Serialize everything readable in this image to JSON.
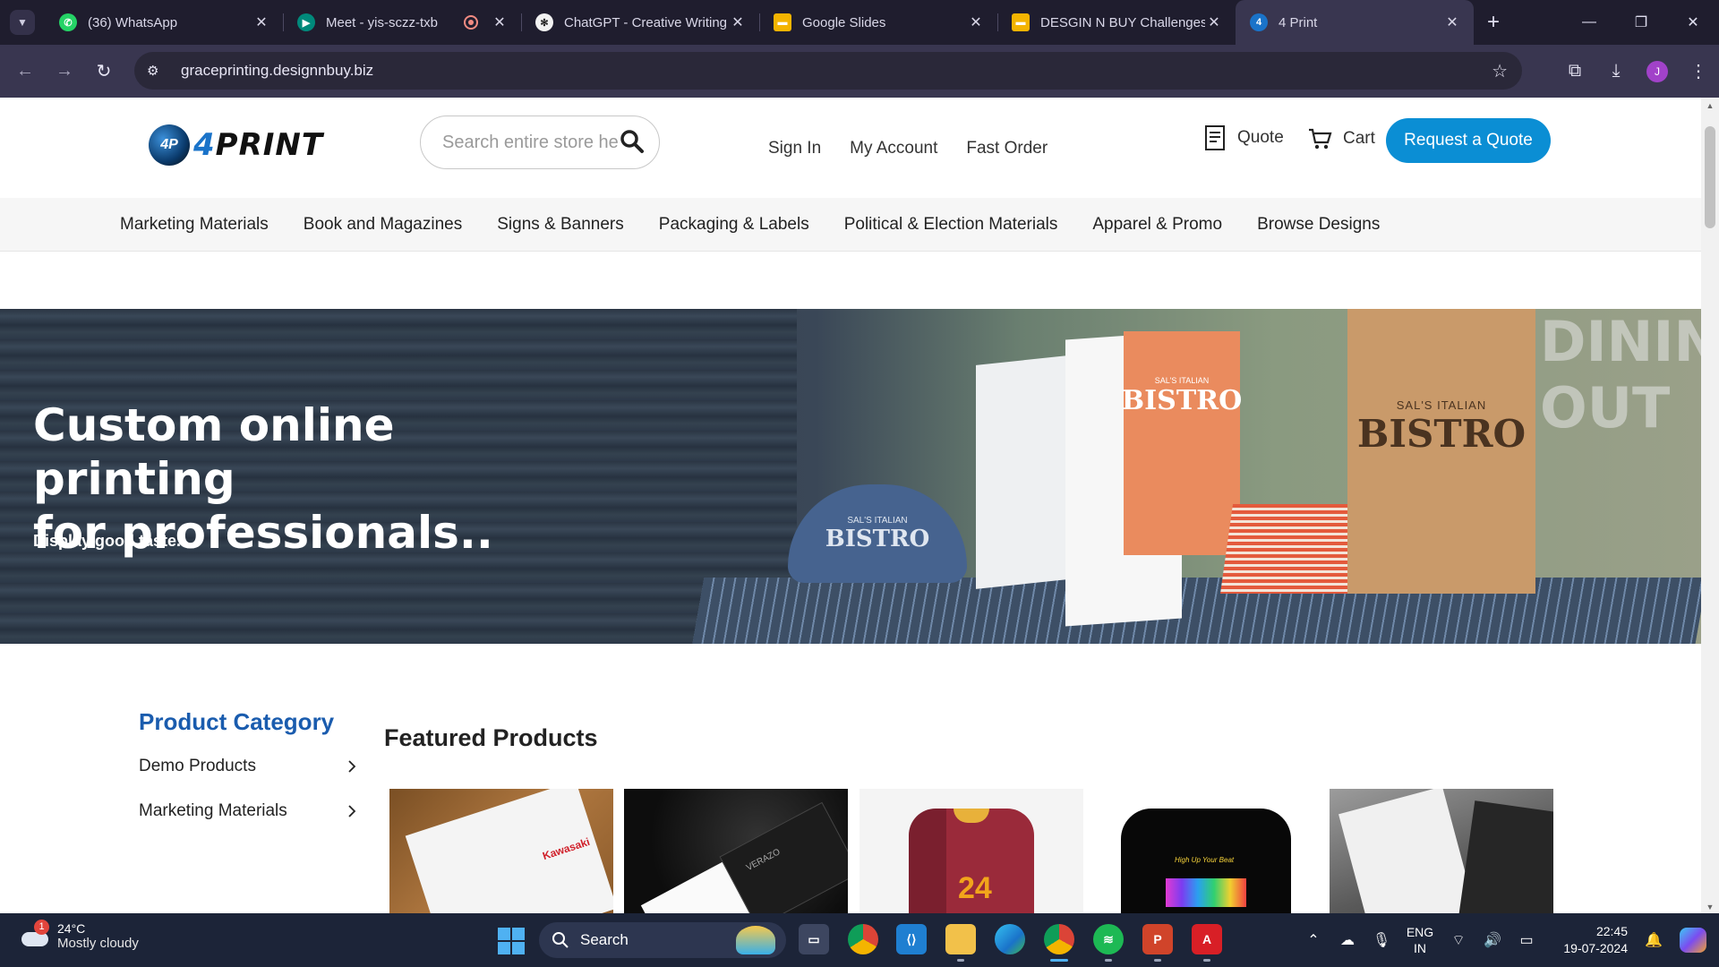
{
  "browser": {
    "tabs": [
      {
        "title": "(36) WhatsApp",
        "icon": "whatsapp-icon",
        "color": "#25d366",
        "glyph": "✆"
      },
      {
        "title": "Meet - yis-sczz-txb",
        "icon": "google-meet-icon",
        "color": "#00897b",
        "glyph": "▶"
      },
      {
        "title": "ChatGPT - Creative Writing",
        "icon": "chatgpt-icon",
        "color": "#f2f2f2",
        "glyph": "✻"
      },
      {
        "title": "Google Slides",
        "icon": "google-slides-icon",
        "color": "#f4b400",
        "glyph": "▬"
      },
      {
        "title": "DESGIN N BUY Challenges",
        "icon": "google-slides-icon",
        "color": "#f4b400",
        "glyph": "▬"
      },
      {
        "title": "4 Print",
        "icon": "4print-favicon-icon",
        "color": "#1a73c9",
        "glyph": "4"
      }
    ],
    "active_tab_index": 5,
    "url": "graceprinting.designnbuy.biz",
    "profile_initial": "J"
  },
  "header": {
    "logo_prefix": "4",
    "logo_text": "PRINT",
    "logo_globe_text": "4P",
    "search_placeholder": "Search entire store here...",
    "links": [
      "Sign In",
      "My Account",
      "Fast Order"
    ],
    "quote_label": "Quote",
    "cart_label": "Cart",
    "request_quote_label": "Request a Quote"
  },
  "nav": {
    "categories": [
      "Marketing Materials",
      "Book and Magazines",
      "Signs & Banners",
      "Packaging & Labels",
      "Political & Election Materials",
      "Apparel & Promo",
      "Browse Designs"
    ]
  },
  "hero": {
    "title_line1": "Custom online printing",
    "title_line2": "for professionals..",
    "subtitle": "Display good taste.",
    "cap_small": "SAL'S ITALIAN",
    "cap_big": "BISTRO",
    "menu_small": "SAL'S ITALIAN",
    "menu_big": "BISTRO",
    "bag_small": "SAL'S ITALIAN",
    "bag_big": "BISTRO",
    "background_text": "DINING OUT"
  },
  "sidebar": {
    "title": "Product Category",
    "items": [
      "Demo Products",
      "Marketing Materials"
    ]
  },
  "featured": {
    "title": "Featured Products",
    "products": [
      {
        "name": "notepad",
        "text": "Kawasaki"
      },
      {
        "name": "business-cards",
        "text": "VERAZO"
      },
      {
        "name": "jersey",
        "text": "24"
      },
      {
        "name": "t-shirt",
        "text": "High Up Your Beat"
      },
      {
        "name": "envelopes",
        "text": ""
      }
    ]
  },
  "taskbar": {
    "weather_temp": "24°C",
    "weather_desc": "Mostly cloudy",
    "weather_badge": "1",
    "search_label": "Search",
    "apps": [
      "task-view-icon",
      "chrome-icon",
      "vscode-icon",
      "file-explorer-icon",
      "edge-icon",
      "chrome-profile-icon",
      "spotify-icon",
      "powerpoint-icon",
      "acrobat-icon"
    ],
    "lang_line1": "ENG",
    "lang_line2": "IN",
    "time": "22:45",
    "date": "19-07-2024"
  },
  "colors": {
    "accent": "#0b8ed4",
    "category_title": "#1a5cae",
    "tabstrip_bg": "#1f1d2e",
    "toolbar_bg": "#393650",
    "taskbar_bg": "#1c2438"
  }
}
